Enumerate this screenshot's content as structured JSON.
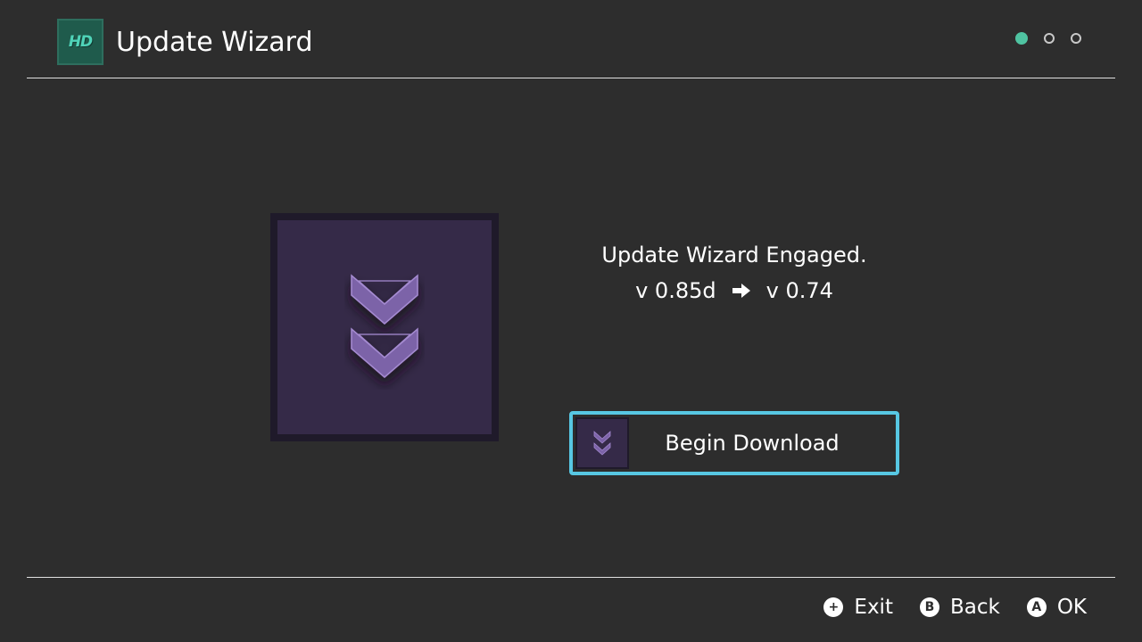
{
  "header": {
    "logo_text": "HD",
    "title": "Update Wizard",
    "page_indicator": {
      "current": 1,
      "total": 3
    }
  },
  "main": {
    "hero_icon": "double-chevron-down-icon",
    "status_text": "Update Wizard Engaged.",
    "current_version": "v 0.85d",
    "arrow_icon": "arrow-right-icon",
    "target_version": "v 0.74",
    "download_button": {
      "icon": "double-chevron-down-icon",
      "label": "Begin Download"
    }
  },
  "footer": {
    "hints": [
      {
        "icon": "plus-button-icon",
        "glyph": "+",
        "label": "Exit"
      },
      {
        "icon": "b-button-icon",
        "glyph": "B",
        "label": "Back"
      },
      {
        "icon": "a-button-icon",
        "glyph": "A",
        "label": "OK"
      }
    ]
  },
  "colors": {
    "background": "#2d2d2d",
    "accent_selection": "#57c7e3",
    "page_dot_active": "#4fc3a1",
    "tile_purple": "#352a48",
    "chevron": "#7c63a8"
  }
}
